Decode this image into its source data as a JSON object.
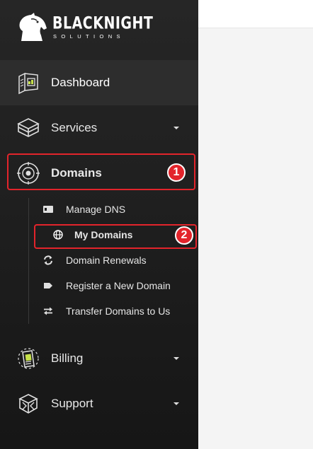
{
  "brand": {
    "name": "BLACKNIGHT",
    "tagline": "SOLUTIONS"
  },
  "nav": {
    "dashboard": {
      "label": "Dashboard",
      "icon": "dashboard-icon"
    },
    "services": {
      "label": "Services",
      "icon": "services-cube-icon"
    },
    "domains": {
      "label": "Domains",
      "icon": "globe-target-icon"
    },
    "billing": {
      "label": "Billing",
      "icon": "billing-document-icon"
    },
    "support": {
      "label": "Support",
      "icon": "support-box-icon"
    }
  },
  "domains_submenu": [
    {
      "label": "Manage DNS",
      "icon": "dns-card-icon"
    },
    {
      "label": "My Domains",
      "icon": "globe-icon"
    },
    {
      "label": "Domain Renewals",
      "icon": "refresh-icon"
    },
    {
      "label": "Register a New Domain",
      "icon": "tag-icon"
    },
    {
      "label": "Transfer Domains to Us",
      "icon": "transfer-arrows-icon"
    }
  ],
  "annotations": {
    "step1": "1",
    "step2": "2"
  },
  "colors": {
    "sidebar_bg": "#202020",
    "active_bg": "#2d2d2d",
    "highlight": "#e3242b",
    "content_bg": "#f4f4f4"
  }
}
